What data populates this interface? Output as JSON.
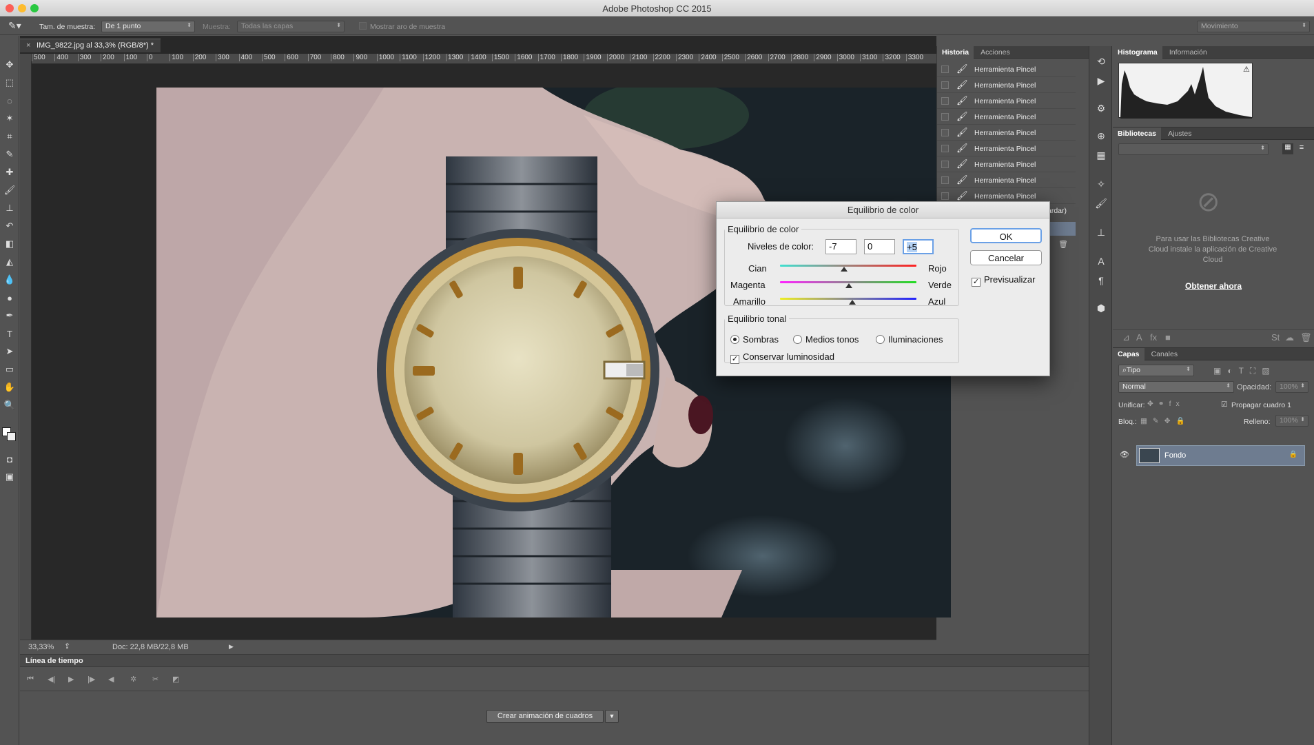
{
  "app": {
    "title": "Adobe Photoshop CC 2015"
  },
  "options": {
    "sample_size_label": "Tam. de muestra:",
    "sample_size_value": "De 1 punto",
    "sample_label": "Muestra:",
    "sample_value": "Todas las capas",
    "show_ring": "Mostrar aro de muestra",
    "workspace": "Movimiento"
  },
  "document": {
    "tab": "IMG_9822.jpg al 33,3% (RGB/8*) *",
    "ruler_h": [
      "500",
      "400",
      "300",
      "200",
      "100",
      "0",
      "100",
      "200",
      "300",
      "400",
      "500",
      "600",
      "700",
      "800",
      "900",
      "1000",
      "1100",
      "1200",
      "1300",
      "1400",
      "1500",
      "1600",
      "1700",
      "1800",
      "1900",
      "2000",
      "2100",
      "2200",
      "2300",
      "2400",
      "2500",
      "2600",
      "2700",
      "2800",
      "2900",
      "3000",
      "3100",
      "3200",
      "3300"
    ],
    "zoom": "33,33%",
    "doc_size": "Doc: 22,8 MB/22,8 MB"
  },
  "timeline": {
    "title": "Línea de tiempo",
    "create_button": "Crear animación de cuadros"
  },
  "history": {
    "tabs": [
      "Historia",
      "Acciones"
    ],
    "items": [
      "Herramienta Pincel",
      "Herramienta Pincel",
      "Herramienta Pincel",
      "Herramienta Pincel",
      "Herramienta Pincel",
      "Herramienta Pincel",
      "Herramienta Pincel",
      "Herramienta Pincel",
      "Herramienta Pincel"
    ],
    "partial": "ardar)"
  },
  "histogram": {
    "tabs": [
      "Histograma",
      "Información"
    ]
  },
  "libraries": {
    "tabs": [
      "Bibliotecas",
      "Ajustes"
    ],
    "message": "Para usar las Bibliotecas Creative Cloud instale la aplicación de Creative Cloud",
    "link": "Obtener ahora"
  },
  "layers": {
    "tabs": [
      "Capas",
      "Canales"
    ],
    "filter": "Tipo",
    "blend": "Normal",
    "opacity_label": "Opacidad:",
    "opacity": "100%",
    "unify_label": "Unificar:",
    "propagate": "Propagar cuadro 1",
    "lock_label": "Bloq.:",
    "fill_label": "Relleno:",
    "fill": "100%",
    "layer_name": "Fondo"
  },
  "dialog": {
    "title": "Equilibrio de color",
    "group1": "Equilibrio de color",
    "levels_label": "Niveles de color:",
    "levels": [
      "-7",
      "0",
      "+5"
    ],
    "sliders": [
      {
        "left": "Cian",
        "right": "Rojo",
        "value": -7
      },
      {
        "left": "Magenta",
        "right": "Verde",
        "value": 0
      },
      {
        "left": "Amarillo",
        "right": "Azul",
        "value": 5
      }
    ],
    "group2": "Equilibrio tonal",
    "tones": [
      "Sombras",
      "Medios tonos",
      "Iluminaciones"
    ],
    "selected_tone": "Sombras",
    "preserve": "Conservar luminosidad",
    "ok": "OK",
    "cancel": "Cancelar",
    "preview": "Previsualizar"
  }
}
